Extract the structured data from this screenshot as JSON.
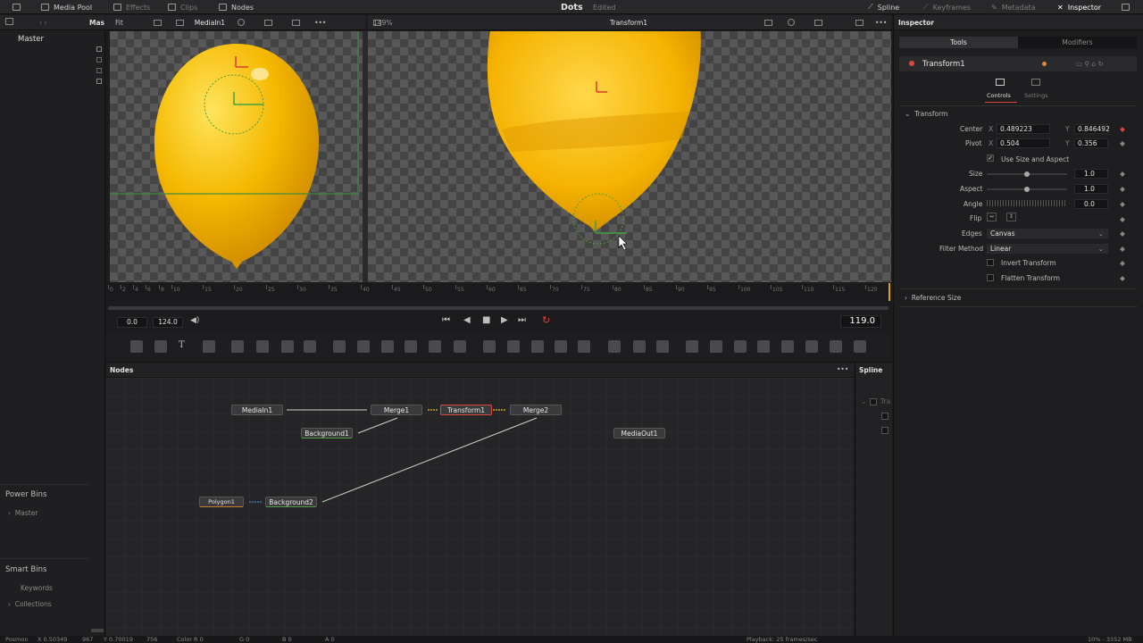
{
  "topbar": {
    "media_pool": "Media Pool",
    "effects": "Effects",
    "clips": "Clips",
    "nodes": "Nodes",
    "project": "Dots",
    "status": "Edited",
    "spline": "Spline",
    "keyframes": "Keyframes",
    "metadata": "Metadata",
    "inspector": "Inspector"
  },
  "sidebar": {
    "header": "Mas",
    "master": "Master",
    "power_bins": "Power Bins",
    "power_master": "Master",
    "smart_bins": "Smart Bins",
    "keywords": "Keywords",
    "collections": "Collections"
  },
  "viewer_left": {
    "fit": "Fit",
    "clip": "MediaIn1",
    "zoom": "149%"
  },
  "viewer_right": {
    "title": "Transform1"
  },
  "timeline": {
    "ticks": [
      "0",
      "2",
      "4",
      "6",
      "8",
      "10",
      "15",
      "20",
      "25",
      "30",
      "35",
      "40",
      "45",
      "50",
      "55",
      "60",
      "65",
      "70",
      "75",
      "80",
      "85",
      "90",
      "95",
      "100",
      "105",
      "110",
      "115",
      "120"
    ],
    "start": "0.0",
    "end": "124.0",
    "current": "119.0"
  },
  "nodes_panel": {
    "title": "Nodes",
    "spline_title": "Spline",
    "spline_item": "Tra",
    "nodes": {
      "mediain1": "MediaIn1",
      "merge1": "Merge1",
      "transform1": "Transform1",
      "merge2": "Merge2",
      "background1": "Background1",
      "mediaout1": "MediaOut1",
      "polygon1": "Polygon1",
      "background2": "Background2"
    }
  },
  "inspector": {
    "title": "Inspector",
    "tabs": [
      "Tools",
      "Modifiers"
    ],
    "node": "Transform1",
    "sub_tabs": [
      "Controls",
      "Settings"
    ],
    "section": "Transform",
    "center_label": "Center",
    "center_x": "0.489223",
    "center_y": "0.846492",
    "pivot_label": "Pivot",
    "pivot_x": "0.504",
    "pivot_y": "0.356",
    "x_label": "X",
    "y_label": "Y",
    "use_size_aspect": "Use Size and Aspect",
    "size_label": "Size",
    "size": "1.0",
    "size_level": 0.5,
    "aspect_label": "Aspect",
    "aspect": "1.0",
    "aspect_level": 0.5,
    "angle_label": "Angle",
    "angle": "0.0",
    "flip_label": "Flip",
    "edges_label": "Edges",
    "edges": "Canvas",
    "filter_label": "Filter Method",
    "filter": "Linear",
    "invert": "Invert Transform",
    "flatten": "Flatten Transform",
    "reference": "Reference Size"
  },
  "statusbar": {
    "posmon": "Posmon",
    "x": "X 0.50349",
    "xpx": "967",
    "y": "Y 0.70019",
    "ypx": "756",
    "color_r": "Color R 0",
    "g": "G 0",
    "b": "B 0",
    "a": "A 0",
    "playback": "Playback: 25 frames/sec",
    "memory": "10% - 3352 MB"
  },
  "colors": {
    "accent": "#e0463c",
    "balloon": "#f5b800",
    "node_link": "#e8c028"
  }
}
